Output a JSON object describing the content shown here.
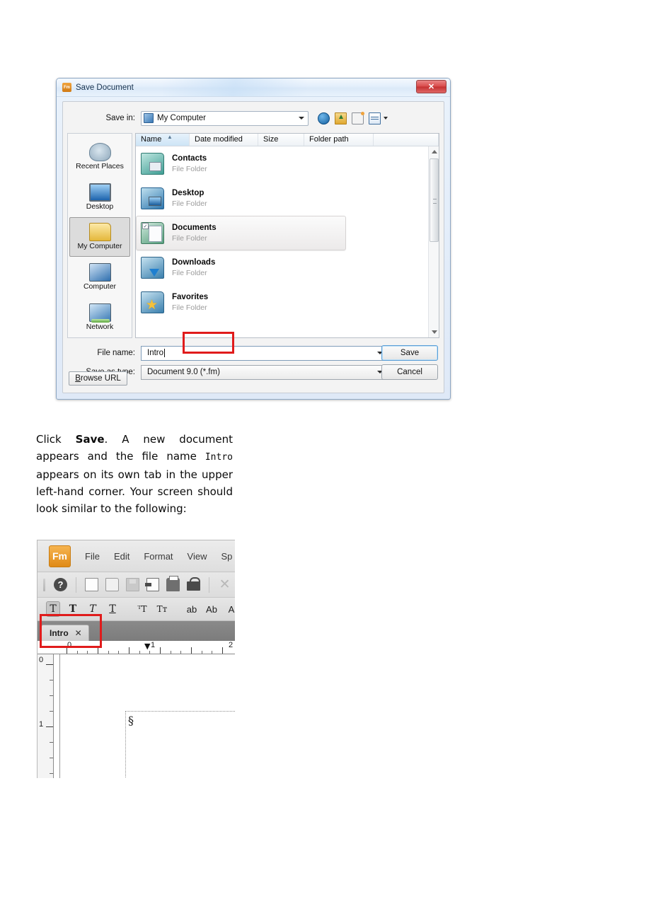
{
  "dialog": {
    "title": "Save Document",
    "app_icon": "Fm",
    "close_label": "✕",
    "save_in": {
      "label": "Save in:",
      "value": "My Computer",
      "icon": "my-computer-icon"
    },
    "nav_buttons": [
      {
        "name": "back-icon",
        "label": ""
      },
      {
        "name": "up-folder-icon",
        "label": ""
      },
      {
        "name": "new-folder-icon",
        "label": ""
      },
      {
        "name": "views-icon",
        "label": ""
      }
    ],
    "places": [
      {
        "label": "Recent Places",
        "icon": "recent-places-icon",
        "selected": false
      },
      {
        "label": "Desktop",
        "icon": "desktop-icon",
        "selected": false
      },
      {
        "label": "My Computer",
        "icon": "my-computer-icon",
        "selected": true
      },
      {
        "label": "Computer",
        "icon": "computer-icon",
        "selected": false
      },
      {
        "label": "Network",
        "icon": "network-icon",
        "selected": false
      }
    ],
    "columns": [
      {
        "label": "Name",
        "sorted": true,
        "sort_mark": "▲"
      },
      {
        "label": "Date modified",
        "sorted": false,
        "sort_mark": ""
      },
      {
        "label": "Size",
        "sorted": false,
        "sort_mark": ""
      },
      {
        "label": "Folder path",
        "sorted": false,
        "sort_mark": ""
      },
      {
        "label": "",
        "sorted": false,
        "sort_mark": ""
      }
    ],
    "files": [
      {
        "name": "Contacts",
        "type": "File Folder",
        "icon": "folder-contacts-icon",
        "hover": false
      },
      {
        "name": "Desktop",
        "type": "File Folder",
        "icon": "folder-desktop-icon",
        "hover": false
      },
      {
        "name": "Documents",
        "type": "File Folder",
        "icon": "folder-documents-icon",
        "hover": true
      },
      {
        "name": "Downloads",
        "type": "File Folder",
        "icon": "folder-downloads-icon",
        "hover": false
      },
      {
        "name": "Favorites",
        "type": "File Folder",
        "icon": "folder-favorites-icon",
        "hover": false
      }
    ],
    "file_name": {
      "label": "File name:",
      "value": "Intro"
    },
    "save_as_type": {
      "label": "Save as type:",
      "value": "Document 9.0 (*.fm)"
    },
    "buttons": {
      "save": "Save",
      "cancel": "Cancel",
      "browse_url_accel": "B",
      "browse_url_rest": "rowse URL"
    }
  },
  "body_text": {
    "p1": "Click ",
    "bold1": "Save",
    "p2": ". A new document appears and the file name ",
    "mono1": "Intro",
    "p3": " appears on its own tab in the upper left-hand corner. Your screen should look similar to the following:"
  },
  "framemaker": {
    "logo": "Fm",
    "menus": [
      "File",
      "Edit",
      "Format",
      "View",
      "Sp"
    ],
    "toolbar_icons": [
      {
        "name": "help-icon",
        "glyph": "?"
      },
      {
        "name": "new-document-icon",
        "glyph": ""
      },
      {
        "name": "open-folder-icon",
        "glyph": ""
      },
      {
        "name": "save-icon",
        "glyph": ""
      },
      {
        "name": "import-icon",
        "glyph": ""
      },
      {
        "name": "print-icon",
        "glyph": ""
      },
      {
        "name": "lock-icon",
        "glyph": ""
      },
      {
        "name": "close-document-icon",
        "glyph": "✕"
      }
    ],
    "char_toolbar": [
      {
        "name": "text-plain-button",
        "glyph": "T",
        "active": true,
        "sans": false
      },
      {
        "name": "text-bold-button",
        "glyph": "T",
        "active": false,
        "sans": false
      },
      {
        "name": "text-italic-button",
        "glyph": "T",
        "active": false,
        "sans": false
      },
      {
        "name": "text-underline-button",
        "glyph": "T",
        "active": false,
        "sans": false
      },
      {
        "name": "text-superscript-button",
        "glyph": "ᵀT",
        "active": false,
        "sans": false
      },
      {
        "name": "text-subscript-button",
        "glyph": "Tт",
        "active": false,
        "sans": false
      },
      {
        "name": "lowercase-button",
        "glyph": "ab",
        "active": false,
        "sans": true
      },
      {
        "name": "capitalize-button",
        "glyph": "Ab",
        "active": false,
        "sans": true
      },
      {
        "name": "uppercase-button",
        "glyph": "A",
        "active": false,
        "sans": true
      }
    ],
    "tab": {
      "label": "Intro",
      "close": "✕"
    },
    "ruler": {
      "h_labels": [
        "0",
        "1",
        "2"
      ],
      "v_labels": [
        "0",
        "1"
      ],
      "marker": "▼"
    },
    "page": {
      "paragraph_symbol": "§"
    }
  },
  "annotations": {
    "highlight_color": "#e01b1b",
    "filename_box": "file-name-highlight",
    "tab_box": "document-tab-highlight"
  }
}
